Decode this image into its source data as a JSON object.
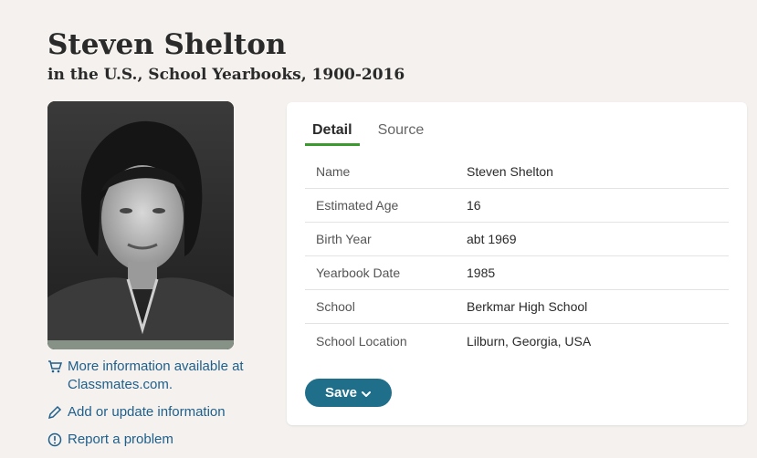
{
  "record": {
    "title": "Steven Shelton",
    "collection": "in the U.S., School Yearbooks, 1900-2016"
  },
  "photo": {
    "icon": "portrait-photo"
  },
  "side_links": [
    {
      "icon": "cart-icon",
      "label": "More information available at Classmates.com."
    },
    {
      "icon": "pencil-icon",
      "label": "Add or update information"
    },
    {
      "icon": "alert-circle-icon",
      "label": "Report a problem"
    }
  ],
  "tabs": [
    {
      "label": "Detail",
      "active": true
    },
    {
      "label": "Source",
      "active": false
    }
  ],
  "details": [
    {
      "label": "Name",
      "value": "Steven Shelton"
    },
    {
      "label": "Estimated Age",
      "value": "16"
    },
    {
      "label": "Birth Year",
      "value": "abt 1969"
    },
    {
      "label": "Yearbook Date",
      "value": "1985"
    },
    {
      "label": "School",
      "value": "Berkmar High School"
    },
    {
      "label": "School Location",
      "value": "Lilburn, Georgia, USA"
    }
  ],
  "actions": {
    "save_label": "Save",
    "save_icon": "chevron-down-icon"
  },
  "colors": {
    "page_bg": "#f4f1ee",
    "link": "#1f5f8b",
    "tab_active_underline": "#3a9a2d",
    "save_button": "#1f6f8b"
  }
}
